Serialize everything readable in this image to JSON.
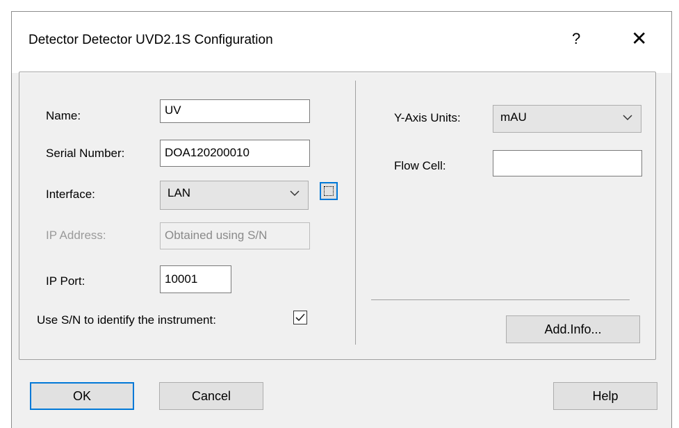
{
  "dialog": {
    "title": "Detector Detector UVD2.1S Configuration",
    "help_glyph": "?",
    "close_glyph": "✕"
  },
  "form": {
    "name_label": "Name:",
    "name_value": "UV",
    "serial_label": "Serial Number:",
    "serial_value": "DOA120200010",
    "interface_label": "Interface:",
    "interface_value": "LAN",
    "ip_address_label": "IP Address:",
    "ip_address_value": "Obtained using S/N",
    "ip_port_label": "IP Port:",
    "ip_port_value": "10001",
    "use_sn_label": "Use S/N to identify the instrument:",
    "use_sn_checked": true,
    "yaxis_label": "Y-Axis Units:",
    "yaxis_value": "mAU",
    "flowcell_label": "Flow Cell:",
    "flowcell_value": "",
    "addinfo_label": "Add.Info..."
  },
  "buttons": {
    "ok": "OK",
    "cancel": "Cancel",
    "help": "Help"
  },
  "colors": {
    "dialog_bg": "#f0f0f0",
    "accent": "#0078d7"
  }
}
